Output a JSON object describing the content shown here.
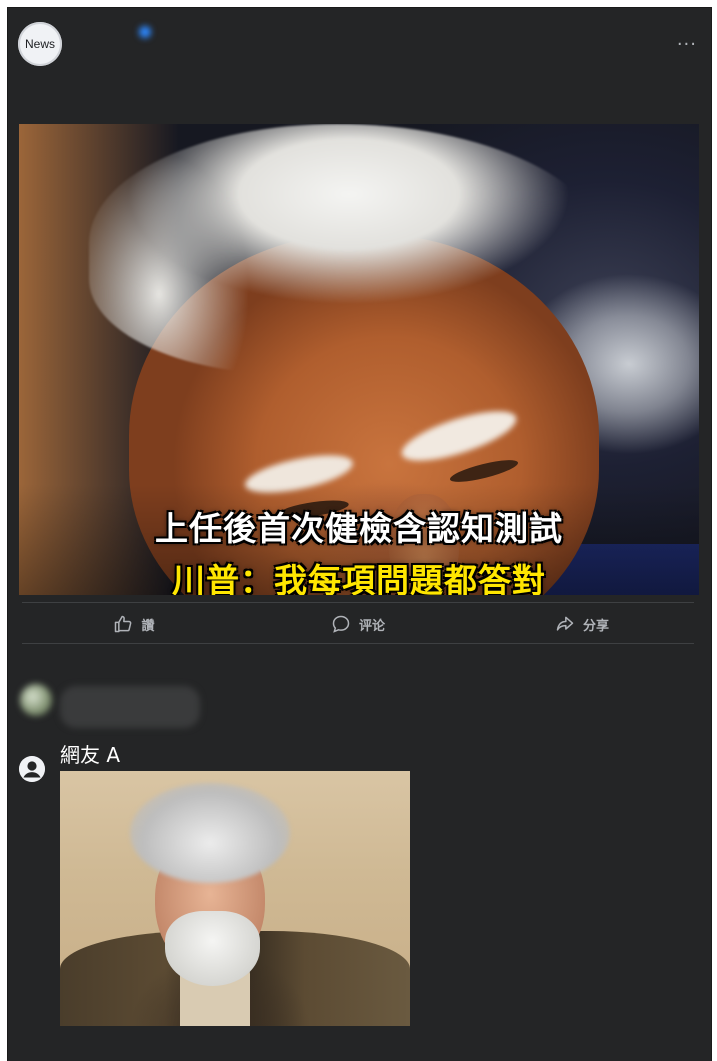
{
  "post": {
    "avatar_label": "News",
    "page_name": "",
    "meta": "",
    "more": "···",
    "text": "",
    "link": ""
  },
  "media": {
    "caption_line1": "上任後首次健檢含認知測試",
    "caption_line2": "川普：我每項問題都答對"
  },
  "actions": {
    "like": "讚",
    "comment": "评论",
    "share": "分享"
  },
  "comments": {
    "sort_label": "",
    "first": {
      "name": "",
      "text": ""
    },
    "second": {
      "name": "網友 A"
    }
  },
  "colors": {
    "background": "#242526",
    "caption_white": "#ffffff",
    "caption_yellow": "#ffe600",
    "muted_text": "#b0b3b8"
  }
}
